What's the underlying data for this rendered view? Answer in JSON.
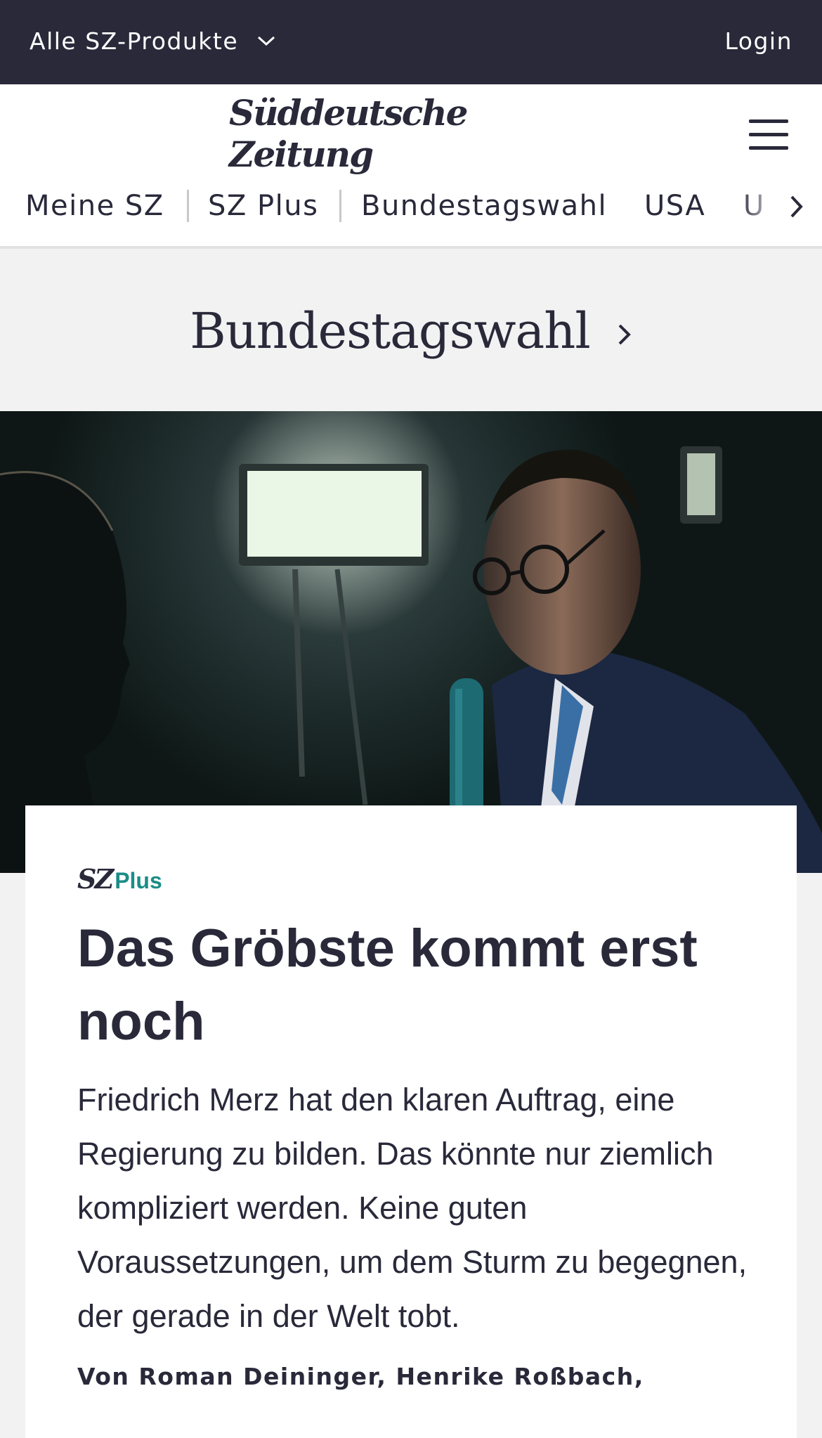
{
  "topbar": {
    "products_label": "Alle SZ-Produkte",
    "login_label": "Login"
  },
  "header": {
    "logo_text": "Süddeutsche Zeitung",
    "nav": [
      "Meine SZ",
      "SZ Plus",
      "Bundestagswahl",
      "USA",
      "U"
    ]
  },
  "section": {
    "title": "Bundestagswahl"
  },
  "article": {
    "badge_sz": "SZ",
    "badge_plus": "Plus",
    "headline": "Das Gröbste kommt erst noch",
    "teaser": "Friedrich Merz hat den klaren Auftrag, eine Regierung zu bilden. Das könnte nur ziemlich kompliziert werden. Keine guten Voraussetzungen, um dem Sturm zu begegnen, der gerade in der Welt tobt.",
    "byline": "Von Roman Deininger, Henrike Roßbach,"
  },
  "colors": {
    "topbar_bg": "#29293a",
    "text": "#29293a",
    "plus_accent": "#1a8d86",
    "page_bg": "#f2f2f2"
  },
  "icons": {
    "products": "chevron-down-icon",
    "menu": "hamburger-menu-icon",
    "nav_scroll": "chevron-right-icon",
    "section_link": "chevron-right-icon"
  }
}
